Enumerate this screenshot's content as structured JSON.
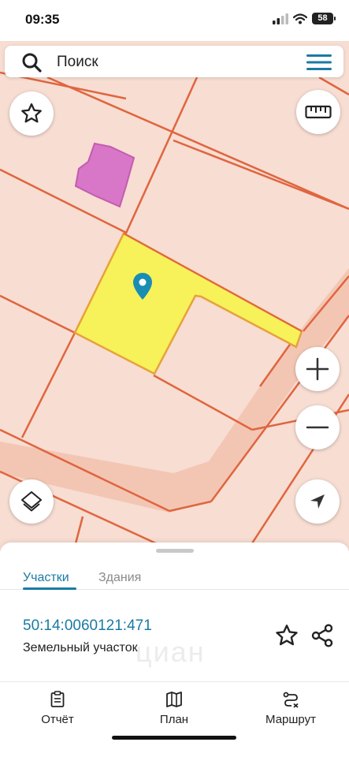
{
  "status_bar": {
    "time": "09:35",
    "battery": "58"
  },
  "search": {
    "placeholder": "Поиск"
  },
  "map": {
    "highlight_color": "#f7f15a",
    "border_color": "#e0653f",
    "building_color": "#d877c8",
    "pin_color": "#1a8db3",
    "buttons": [
      "star-icon",
      "ruler-icon",
      "zoom-in-icon",
      "zoom-out-icon",
      "layers-icon",
      "navigate-icon"
    ]
  },
  "sheet": {
    "tabs": [
      {
        "label": "Участки",
        "active": true
      },
      {
        "label": "Здания",
        "active": false
      }
    ],
    "parcel": {
      "cadastral_number": "50:14:0060121:471",
      "type": "Земельный участок"
    },
    "watermark": "циан"
  },
  "bottom_nav": [
    {
      "label": "Отчёт",
      "icon": "report-icon"
    },
    {
      "label": "План",
      "icon": "map-plan-icon"
    },
    {
      "label": "Маршрут",
      "icon": "route-icon"
    }
  ]
}
